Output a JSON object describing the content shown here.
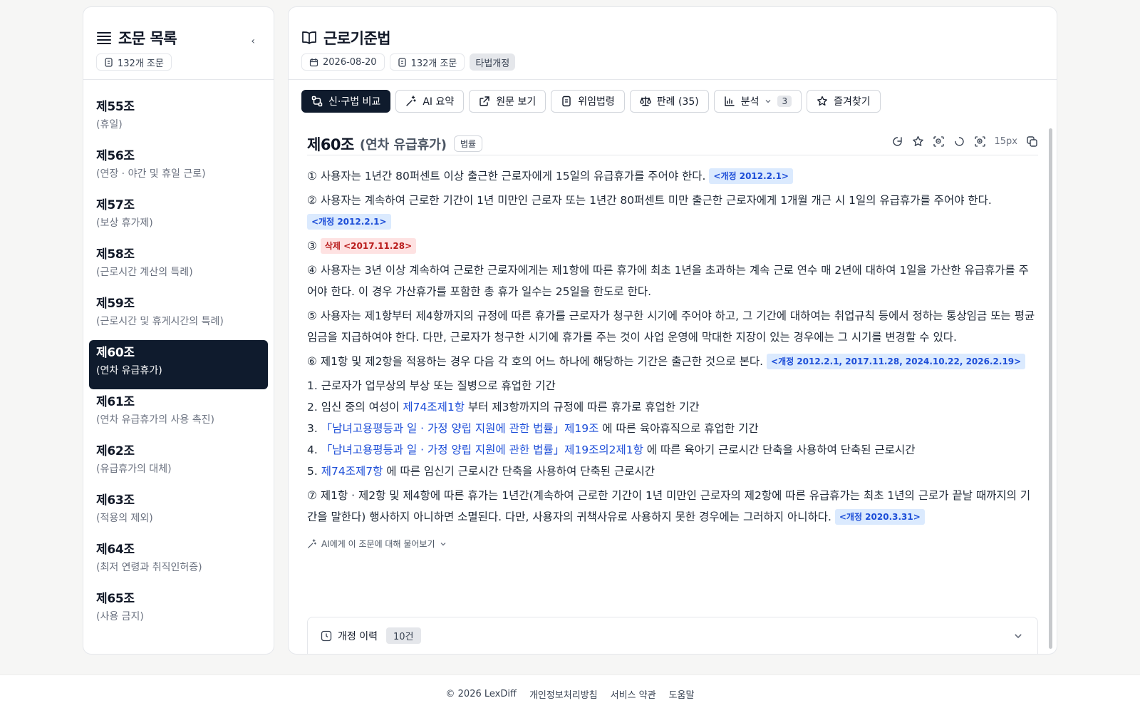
{
  "sidebar": {
    "title": "조문 목록",
    "collapse_icon": "‹",
    "count_label": "132개 조문",
    "items": [
      {
        "num": "제55조",
        "sub": "(휴일)"
      },
      {
        "num": "제56조",
        "sub": "(연장 · 야간 및 휴일 근로)"
      },
      {
        "num": "제57조",
        "sub": "(보상 휴가제)"
      },
      {
        "num": "제58조",
        "sub": "(근로시간 계산의 특례)"
      },
      {
        "num": "제59조",
        "sub": "(근로시간 및 휴게시간의 특례)"
      },
      {
        "num": "제60조",
        "sub": "(연차 유급휴가)"
      },
      {
        "num": "제61조",
        "sub": "(연차 유급휴가의 사용 촉진)"
      },
      {
        "num": "제62조",
        "sub": "(유급휴가의 대체)"
      },
      {
        "num": "제63조",
        "sub": "(적용의 제외)"
      },
      {
        "num": "제64조",
        "sub": "(최저 연령과 취직인허증)"
      },
      {
        "num": "제65조",
        "sub": "(사용 금지)"
      }
    ]
  },
  "header": {
    "title": "근로기준법",
    "date": "2026-08-20",
    "count": "132개 조문",
    "tag": "타법개정"
  },
  "toolbar": {
    "compare": "신·구법 비교",
    "ai_summary": "AI 요약",
    "original": "원문 보기",
    "delegated": "위임법령",
    "cases": "판례 (35)",
    "analysis": "분석",
    "analysis_count": "3",
    "favorite": "즐겨찾기"
  },
  "article": {
    "num": "제60조",
    "title": "(연차 유급휴가)",
    "badge": "법률",
    "font_size": "15px",
    "p1_text": "① 사용자는 1년간 80퍼센트 이상 출근한 근로자에게 15일의 유급휴가를 주어야 한다.",
    "p1_amend": "<개정 2012.2.1>",
    "p2_text": "② 사용자는 계속하여 근로한 기간이 1년 미만인 근로자 또는 1년간 80퍼센트 미만 출근한 근로자에게 1개월 개근 시 1일의 유급휴가를 주어야 한다.",
    "p2_amend": "<개정 2012.2.1>",
    "p3_text": "③",
    "p3_del": "삭제 <2017.11.28>",
    "p4_text": "④ 사용자는 3년 이상 계속하여 근로한 근로자에게는 제1항에 따른 휴가에 최초 1년을 초과하는 계속 근로 연수 매 2년에 대하여 1일을 가산한 유급휴가를 주어야 한다. 이 경우 가산휴가를 포함한 총 휴가 일수는 25일을 한도로 한다.",
    "p5_text": "⑤ 사용자는 제1항부터 제4항까지의 규정에 따른 휴가를 근로자가 청구한 시기에 주어야 하고, 그 기간에 대하여는 취업규칙 등에서 정하는 통상임금 또는 평균임금을 지급하여야 한다. 다만, 근로자가 청구한 시기에 휴가를 주는 것이 사업 운영에 막대한 지장이 있는 경우에는 그 시기를 변경할 수 있다.",
    "p6_text": "⑥ 제1항 및 제2항을 적용하는 경우 다음 각 호의 어느 하나에 해당하는 기간은 출근한 것으로 본다.",
    "p6_amend": "<개정 2012.2.1, 2017.11.28, 2024.10.22, 2026.2.19>",
    "i1": "1. 근로자가 업무상의 부상 또는 질병으로 휴업한 기간",
    "i2_pre": "2. 임신 중의 여성이",
    "i2_link": "제74조제1항",
    "i2_post": "부터 제3항까지의 규정에 따른 휴가로 휴업한 기간",
    "i3_pre": "3.",
    "i3_link": "「남녀고용평등과 일 · 가정 양립 지원에 관한 법률」제19조",
    "i3_post": "에 따른 육아휴직으로 휴업한 기간",
    "i4_pre": "4.",
    "i4_link": "「남녀고용평등과 일 · 가정 양립 지원에 관한 법률」제19조의2제1항",
    "i4_post": "에 따른 육아기 근로시간 단축을 사용하여 단축된 근로시간",
    "i5_pre": "5.",
    "i5_link": "제74조제7항",
    "i5_post": "에 따른 임신기 근로시간 단축을 사용하여 단축된 근로시간",
    "p7_text": "⑦ 제1항 · 제2항 및 제4항에 따른 휴가는 1년간(계속하여 근로한 기간이 1년 미만인 근로자의 제2항에 따른 유급휴가는 최초 1년의 근로가 끝날 때까지의 기간을 말한다) 행사하지 아니하면 소멸된다. 다만, 사용자의 귀책사유로 사용하지 못한 경우에는 그러하지 아니하다.",
    "p7_amend": "<개정 2020.3.31>",
    "ask_ai": "AI에게 이 조문에 대해 물어보기"
  },
  "history": {
    "label": "개정 이력",
    "count": "10건"
  },
  "footer": {
    "copyright": "© 2026 LexDiff",
    "privacy": "개인정보처리방침",
    "terms": "서비스 약관",
    "help": "도움말"
  },
  "colors": {
    "primary": "#0f1b2d",
    "link": "#1d4ed8",
    "amend_bg": "#dbeafe",
    "delete_bg": "#fee2e2"
  }
}
